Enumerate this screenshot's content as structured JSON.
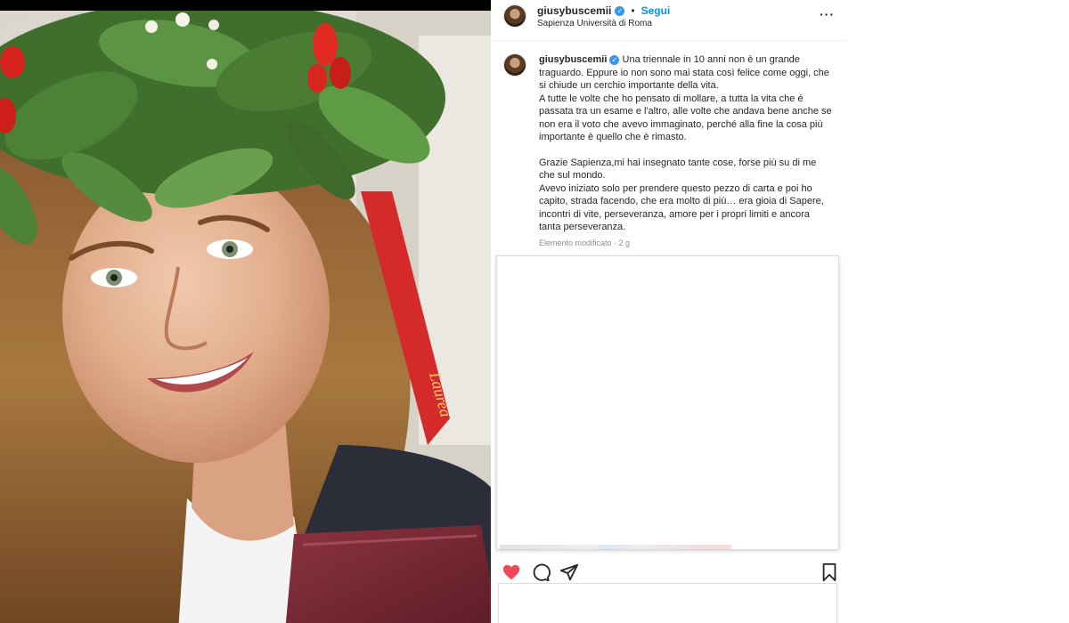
{
  "post": {
    "username": "giusybuscemii",
    "follow_label": "Segui",
    "separator": "•",
    "location": "Sapienza Università di Roma",
    "more_label": "···"
  },
  "caption": {
    "username": "giusybuscemii",
    "paragraph1": "Una triennale in 10 anni non è un grande traguardo. Eppure io non sono mai stata così felice come oggi, che si chiude un cerchio importante della vita.",
    "paragraph2": "A tutte le volte che ho pensato di mollare, a tutta la vita che é passata tra un esame e l'altro, alle volte che andava bene anche se non era il voto che avevo immaginato, perché alla fine la cosa più importante è quello che è rimasto.",
    "paragraph3": "Grazie Sapienza,mi hai insegnato tante cose, forse più su di me che sul mondo.",
    "paragraph4": "Avevo iniziato solo per prendere questo pezzo di carta e poi ho capito, strada facendo, che era molto di più… era gioia di Sapere, incontri di vite, perseveranza, amore per i propri limiti e ancora tanta perseveranza.",
    "meta": "Elemento modificato · 2 g"
  },
  "photo": {
    "ribbon_text": "Laurea"
  },
  "icons": {
    "heart": "heart-icon",
    "comment": "comment-icon",
    "share": "share-icon",
    "bookmark": "bookmark-icon",
    "verified": "verified-icon"
  },
  "colors": {
    "heart": "#ed4956",
    "link": "#0095f6",
    "verified": "#3897f0"
  }
}
